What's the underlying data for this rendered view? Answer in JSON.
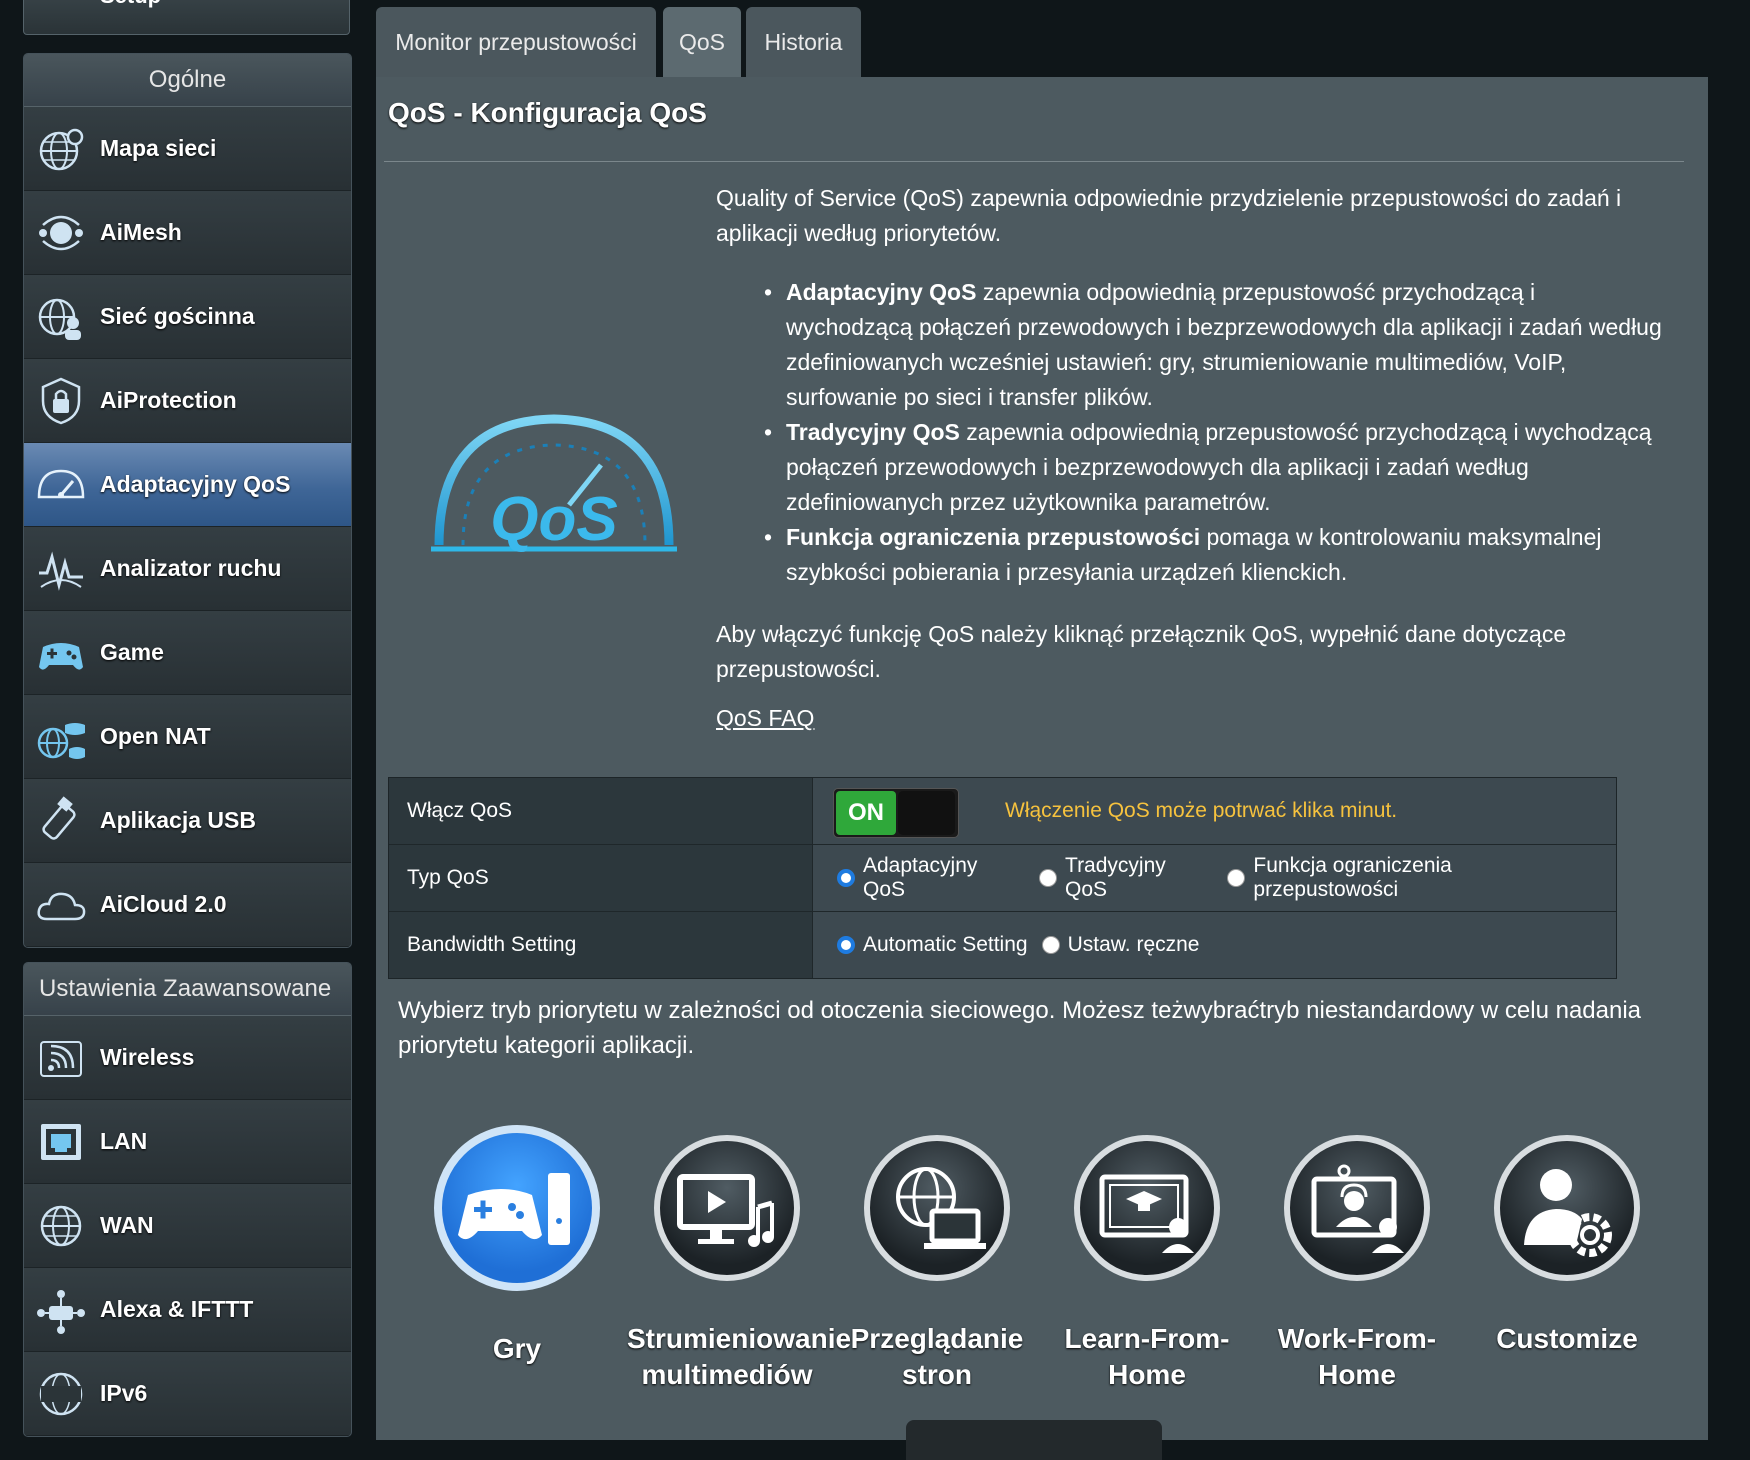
{
  "sidebar": {
    "setup_label": "Setup",
    "general_header": "Ogólne",
    "general_items": [
      {
        "label": "Mapa sieci",
        "icon": "globe-icon"
      },
      {
        "label": "AiMesh",
        "icon": "aimesh-icon"
      },
      {
        "label": "Sieć gościnna",
        "icon": "guest-network-icon"
      },
      {
        "label": "AiProtection",
        "icon": "lock-icon"
      },
      {
        "label": "Adaptacyjny QoS",
        "icon": "speedometer-icon",
        "active": true
      },
      {
        "label": "Analizator ruchu",
        "icon": "traffic-analyzer-icon"
      },
      {
        "label": "Game",
        "icon": "gamepad-icon"
      },
      {
        "label": "Open NAT",
        "icon": "open-nat-icon"
      },
      {
        "label": "Aplikacja USB",
        "icon": "usb-icon"
      },
      {
        "label": "AiCloud 2.0",
        "icon": "cloud-icon"
      }
    ],
    "advanced_header": "Ustawienia Zaawansowane",
    "advanced_items": [
      {
        "label": "Wireless",
        "icon": "wireless-icon"
      },
      {
        "label": "LAN",
        "icon": "lan-icon"
      },
      {
        "label": "WAN",
        "icon": "wan-globe-icon"
      },
      {
        "label": "Alexa & IFTTT",
        "icon": "alexa-icon"
      },
      {
        "label": "IPv6",
        "icon": "ipv6-icon"
      }
    ]
  },
  "tabs": [
    {
      "label": "Monitor przepustowości",
      "active": false
    },
    {
      "label": "QoS",
      "active": true
    },
    {
      "label": "Historia",
      "active": false
    }
  ],
  "main": {
    "title": "QoS - Konfiguracja QoS",
    "intro": "Quality of Service (QoS) zapewnia odpowiednie przydzielenie przepustowości do zadań i aplikacji według priorytetów.",
    "bullets": [
      {
        "bold": "Adaptacyjny QoS",
        "text": " zapewnia odpowiednią przepustowość przychodzącą i wychodzącą połączeń przewodowych i bezprzewodowych dla aplikacji i zadań według zdefiniowanych wcześniej ustawień: gry, strumieniowanie multimediów, VoIP, surfowanie po sieci i transfer plików."
      },
      {
        "bold": "Tradycyjny QoS",
        "text": " zapewnia odpowiednią przepustowość przychodzącą i wychodzącą połączeń przewodowych i bezprzewodowych dla aplikacji i zadań według zdefiniowanych przez użytkownika parametrów."
      },
      {
        "bold": "Funkcja ograniczenia przepustowości",
        "text": " pomaga w kontrolowaniu maksymalnej szybkości pobierania i przesyłania urządzeń klienckich."
      }
    ],
    "enable_text": "Aby włączyć funkcję QoS należy kliknąć przełącznik QoS, wypełnić dane dotyczące przepustowości.",
    "faq_link": "QoS FAQ",
    "logo_text": "QoS"
  },
  "settings": {
    "enable_label": "Włącz QoS",
    "toggle_state": "ON",
    "enable_warning": "Włączenie QoS może potrwać klika minut.",
    "type_label": "Typ QoS",
    "type_options": [
      "Adaptacyjny QoS",
      "Tradycyjny QoS",
      "Funkcja ograniczenia przepustowości"
    ],
    "type_selected": 0,
    "bandwidth_label": "Bandwidth Setting",
    "bandwidth_options": [
      "Automatic Setting",
      "Ustaw. ręczne"
    ],
    "bandwidth_selected": 0
  },
  "modes": {
    "description": "Wybierz tryb priorytetu w zależności od otoczenia sieciowego. Możesz teżwybraćtryb niestandardowy w celu nadania priorytetu kategorii aplikacji.",
    "items": [
      {
        "label_lines": [
          "Gry",
          ""
        ],
        "icon": "game-console-icon",
        "selected": true
      },
      {
        "label_lines": [
          "Strumieniowanie",
          "multimediów"
        ],
        "icon": "media-streaming-icon",
        "selected": false
      },
      {
        "label_lines": [
          "Przeglądanie",
          "stron"
        ],
        "icon": "web-browsing-icon",
        "selected": false
      },
      {
        "label_lines": [
          "Learn-From-",
          "Home"
        ],
        "icon": "learn-from-home-icon",
        "selected": false
      },
      {
        "label_lines": [
          "Work-From-",
          "Home"
        ],
        "icon": "work-from-home-icon",
        "selected": false
      },
      {
        "label_lines": [
          "Customize",
          ""
        ],
        "icon": "customize-user-icon",
        "selected": false
      }
    ]
  },
  "colors": {
    "accent_blue": "#1e7be0",
    "toggle_green": "#2fa83a",
    "warning_yellow": "#f6c23e",
    "gauge_cyan": "#2fb8e8"
  }
}
